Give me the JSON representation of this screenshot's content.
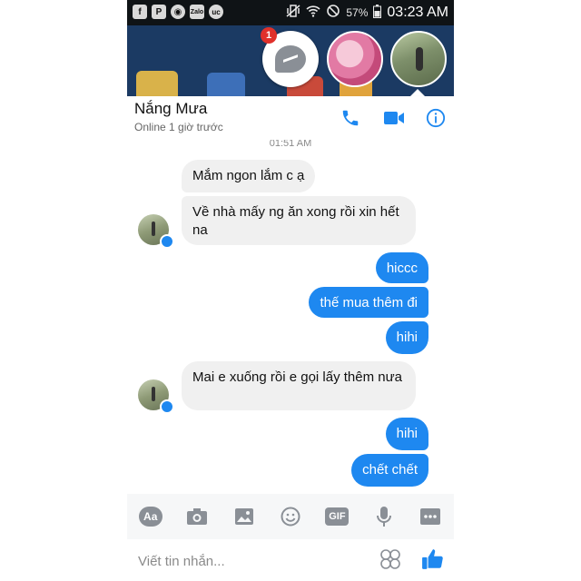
{
  "status_bar": {
    "notification_icons": [
      "facebook-icon",
      "p-app-icon",
      "camera-app-icon",
      "zalo-icon",
      "uc-browser-icon"
    ],
    "zalo_label": "Zalo",
    "battery": "57%",
    "time": "03:23 AM"
  },
  "chat_heads": {
    "unread_count": "1"
  },
  "header": {
    "contact_name": "Nắng Mưa",
    "status": "Online 1 giờ trước"
  },
  "conversation": {
    "timestamp": "01:51 AM",
    "messages": [
      {
        "dir": "in",
        "text": "Mắm ngon lắm c ạ"
      },
      {
        "dir": "in",
        "text": "Về nhà mấy ng ăn xong rồi xin hết na"
      },
      {
        "dir": "out",
        "text": "hiccc"
      },
      {
        "dir": "out",
        "text": "thế mua thêm đi"
      },
      {
        "dir": "out",
        "text": "hihi"
      },
      {
        "dir": "in",
        "text": "Mai e xuống rồi e gọi lấy thêm nưa"
      },
      {
        "dir": "out",
        "text": "hihi"
      },
      {
        "dir": "out",
        "text": "chết chết"
      }
    ]
  },
  "toolbar": {
    "aa_label": "Aa",
    "gif_label": "GIF"
  },
  "composer": {
    "placeholder": "Viết tin nhắn..."
  },
  "colors": {
    "brand_blue": "#1e88f0",
    "incoming_bubble": "#f0f0f0",
    "status_bar": "#0f1316"
  }
}
